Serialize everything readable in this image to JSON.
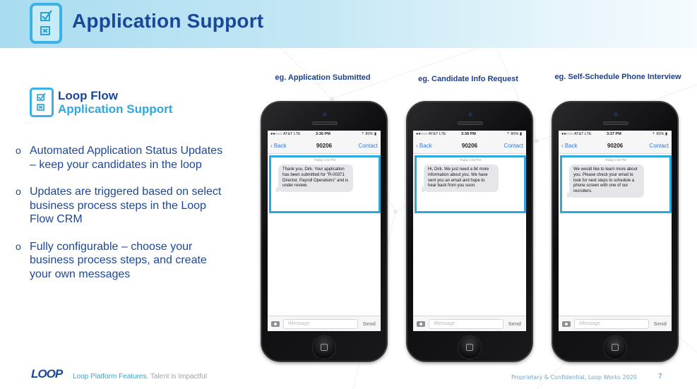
{
  "header": {
    "title": "Application Support",
    "icon": "checklist-icon"
  },
  "brand": {
    "icon": "checklist-icon",
    "line1": "Loop Flow",
    "line2": "Application Support"
  },
  "bullets": [
    {
      "marker": "o",
      "text": "Automated Application Status Updates – keep your candidates in the loop"
    },
    {
      "marker": "o",
      "text": "Updates are triggered based on select business process steps in the Loop Flow CRM"
    },
    {
      "marker": "o",
      "text": "Fully configurable – choose your business process steps, and create your own messages"
    }
  ],
  "phones": [
    {
      "caption": "eg. Application Submitted",
      "status": {
        "carrier": "●●○○○ AT&T LTE",
        "time": "3:36 PM",
        "battery": "⇡ 80% ▮"
      },
      "nav": {
        "back": "Back",
        "title": "90206",
        "contact": "Contact"
      },
      "timestamp": "Today 3:31 PM",
      "message": "Thank you, Dirk. Your application has been submitted for \"R-00371 Director, Payroll Operations\" and is under review.",
      "input_placeholder": "iMessage",
      "send_label": "Send"
    },
    {
      "caption": "eg. Candidate Info Request",
      "status": {
        "carrier": "●●○○○ AT&T LTE",
        "time": "3:38 PM",
        "battery": "⇡ 80% ▮"
      },
      "nav": {
        "back": "Back",
        "title": "90206",
        "contact": "Contact"
      },
      "timestamp": "Today 3:33 PM",
      "message": "Hi, Dirk.  We just need a bit more information about you. We have sent you an email and hope to hear back from you soon.",
      "input_placeholder": "iMessage",
      "send_label": "Send"
    },
    {
      "caption": "eg. Self-Schedule Phone Interview",
      "status": {
        "carrier": "●●○○○ AT&T LTE",
        "time": "3:37 PM",
        "battery": "⇡ 80% ▮"
      },
      "nav": {
        "back": "Back",
        "title": "90206",
        "contact": "Contact"
      },
      "timestamp": "Today 3:32 PM",
      "message": "We would like to learn more about you.  Please check your email to look for next steps to schedule a phone screen with one of our recruiters.",
      "input_placeholder": "iMessage",
      "send_label": "Send"
    }
  ],
  "footer": {
    "logo": "LOOP",
    "tagline_a": "Loop Platform Features.",
    "tagline_b": " Talent is Impactful",
    "confidential": "Proprietary & Confidential, Loop Works 2020",
    "page_number": "7"
  },
  "colors": {
    "brand_dark": "#1b4799",
    "brand_light": "#2ea6e0",
    "highlight_frame": "#2aa9dc",
    "ios_link": "#2f7ad8"
  }
}
